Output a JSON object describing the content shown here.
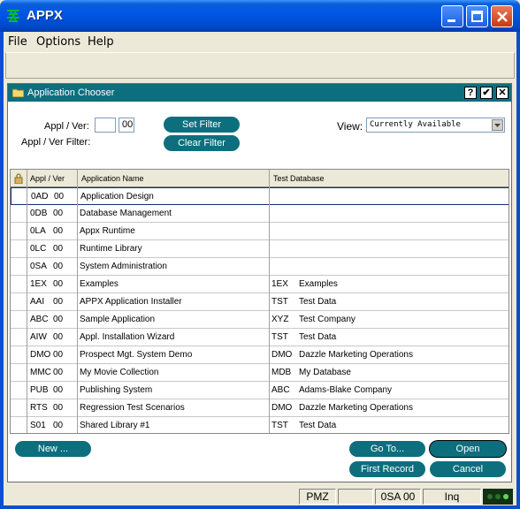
{
  "window": {
    "title": "APPX"
  },
  "menu": [
    "File",
    "Options",
    "Help"
  ],
  "dialog": {
    "title": "Application Chooser",
    "help_btn": "?",
    "ok_btn": "✔",
    "close_btn": "✕",
    "appl_ver_label": "Appl / Ver:",
    "appl_value": "",
    "ver_value": "00",
    "filter_label": "Appl / Ver Filter:",
    "set_filter": "Set Filter",
    "clear_filter": "Clear Filter",
    "view_label": "View:",
    "view_value": "Currently Available"
  },
  "grid": {
    "headers": {
      "appl_ver": "Appl / Ver",
      "app_name": "Application Name",
      "test_db": "Test Database"
    },
    "rows": [
      {
        "appl": "0AD",
        "ver": "00",
        "name": "Application Design",
        "db": "",
        "dbname": ""
      },
      {
        "appl": "0DB",
        "ver": "00",
        "name": "Database Management",
        "db": "",
        "dbname": ""
      },
      {
        "appl": "0LA",
        "ver": "00",
        "name": "Appx Runtime",
        "db": "",
        "dbname": ""
      },
      {
        "appl": "0LC",
        "ver": "00",
        "name": "Runtime Library",
        "db": "",
        "dbname": ""
      },
      {
        "appl": "0SA",
        "ver": "00",
        "name": "System Administration",
        "db": "",
        "dbname": ""
      },
      {
        "appl": "1EX",
        "ver": "00",
        "name": "Examples",
        "db": "1EX",
        "dbname": "Examples"
      },
      {
        "appl": "AAI",
        "ver": "00",
        "name": "APPX Application Installer",
        "db": "TST",
        "dbname": "Test Data"
      },
      {
        "appl": "ABC",
        "ver": "00",
        "name": "Sample Application",
        "db": "XYZ",
        "dbname": "Test Company"
      },
      {
        "appl": "AIW",
        "ver": "00",
        "name": "Appl. Installation Wizard",
        "db": "TST",
        "dbname": "Test Data"
      },
      {
        "appl": "DMO",
        "ver": "00",
        "name": "Prospect Mgt. System Demo",
        "db": "DMO",
        "dbname": "Dazzle Marketing Operations"
      },
      {
        "appl": "MMC",
        "ver": "00",
        "name": "My Movie Collection",
        "db": "MDB",
        "dbname": "My Database"
      },
      {
        "appl": "PUB",
        "ver": "00",
        "name": "Publishing System",
        "db": "ABC",
        "dbname": "Adams-Blake Company"
      },
      {
        "appl": "RTS",
        "ver": "00",
        "name": "Regression Test Scenarios",
        "db": "DMO",
        "dbname": "Dazzle Marketing Operations"
      },
      {
        "appl": "S01",
        "ver": "00",
        "name": "Shared Library #1",
        "db": "TST",
        "dbname": "Test Data"
      }
    ]
  },
  "buttons": {
    "new": "New ...",
    "goto": "Go To...",
    "open": "Open",
    "first": "First Record",
    "cancel": "Cancel"
  },
  "status": {
    "s1": "PMZ",
    "s2": "",
    "s3": "0SA 00",
    "s4": "Inq"
  },
  "colors": {
    "accent": "#0d6f7e",
    "title_bar": "#0055e5"
  }
}
